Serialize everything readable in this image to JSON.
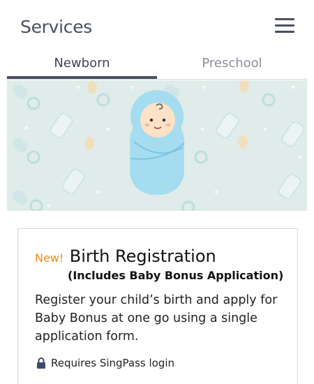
{
  "header": {
    "title": "Services",
    "menu_icon": "hamburger-menu-icon"
  },
  "tabs": [
    {
      "label": "Newborn",
      "active": true
    },
    {
      "label": "Preschool",
      "active": false
    }
  ],
  "banner": {
    "illustration": "swaddled-baby-illustration",
    "background_color": "#dfece9"
  },
  "service_card": {
    "badge": "New!",
    "title": "Birth Registration",
    "subtitle": "(Includes Baby Bonus Application)",
    "description": "Register your child’s birth and apply for Baby Bonus at one go using a single application form.",
    "requirement": "Requires SingPass login",
    "requirement_icon": "lock-icon"
  },
  "colors": {
    "accent_orange": "#f08a1c",
    "header_text": "#4a4f60",
    "inactive_tab": "#8a8e98"
  }
}
